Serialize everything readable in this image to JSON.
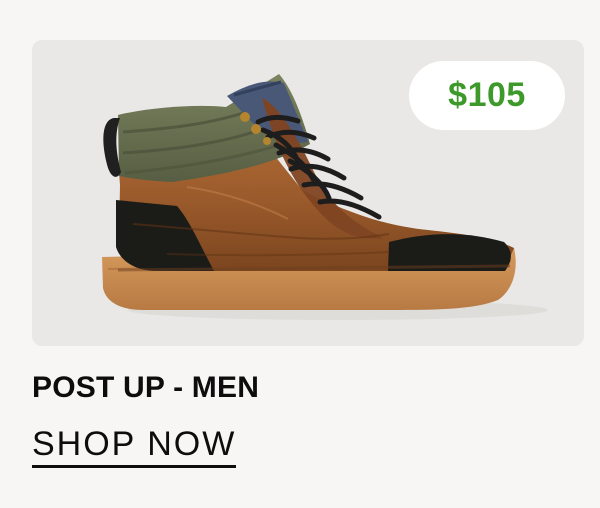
{
  "product": {
    "price": "$105",
    "name": "POST UP - MEN",
    "cta_label": "SHOP NOW",
    "image": "boot-product-image"
  },
  "colors": {
    "page_background": "#f7f6f4",
    "image_background": "#e9e8e6",
    "price_text": "#3d9a2a",
    "price_badge_background": "#ffffff",
    "text": "#0d0d0d",
    "boot_leather": "#9a5a2b",
    "boot_collar": "#68704f",
    "boot_sole": "#c58a50",
    "boot_black_panels": "#1b1b18"
  }
}
